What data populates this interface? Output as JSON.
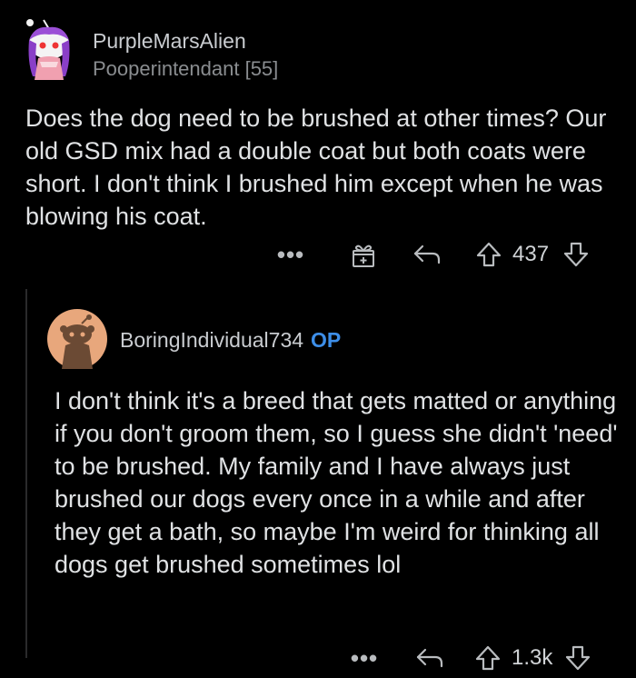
{
  "comment": {
    "username": "PurpleMarsAlien",
    "flair": "Pooperintendant [55]",
    "body": "Does the dog need to be brushed at other times? Our old GSD mix had a double coat but both coats were short. I don't think I brushed him except when he was blowing his coat.",
    "score": "437",
    "more_label": "•••"
  },
  "reply": {
    "username": "BoringIndividual734",
    "op_badge": "OP",
    "body": "I don't think it's a breed that gets matted or anything if you don't groom them, so I guess she didn't 'need' to be brushed. My family and I have always just brushed our dogs every once in a while and after they get a bath, so maybe I'm weird for thinking all dogs get brushed sometimes lol",
    "score": "1.3k",
    "more_label": "•••"
  },
  "icons": [
    "avatar",
    "gift-icon",
    "reply-icon",
    "upvote-icon",
    "downvote-icon"
  ],
  "colors": {
    "background": "#000000",
    "op_badge": "#3d8ee8",
    "avatar_purple": "#7b3fbf",
    "avatar_orange": "#e8a77c"
  }
}
